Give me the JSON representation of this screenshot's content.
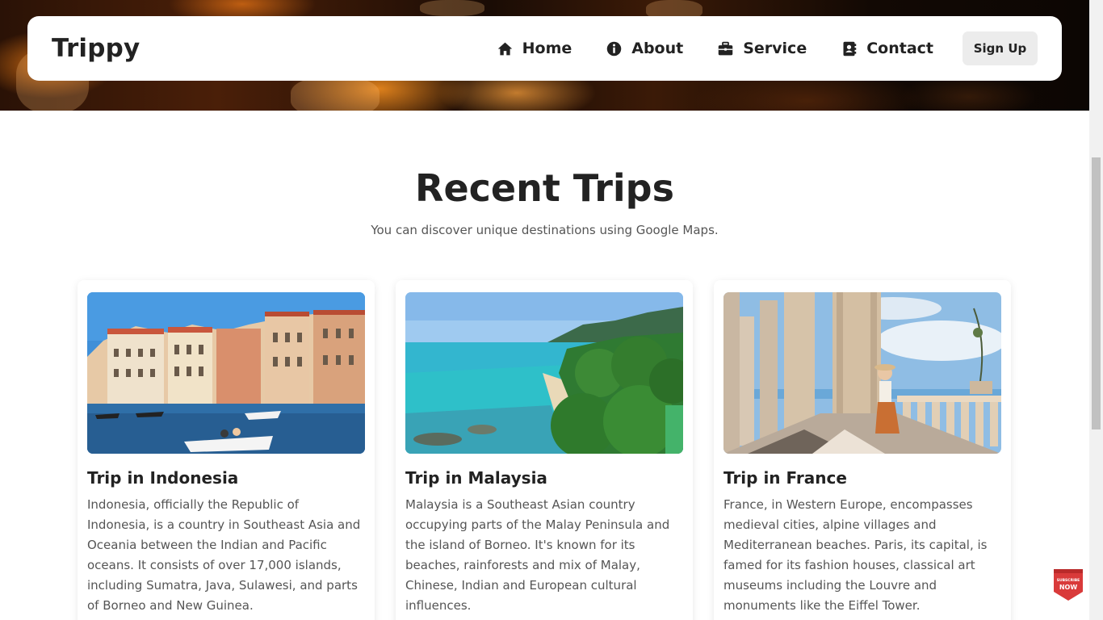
{
  "brand": "Trippy",
  "nav": {
    "items": [
      {
        "label": "Home",
        "icon": "home-icon"
      },
      {
        "label": "About",
        "icon": "info-icon"
      },
      {
        "label": "Service",
        "icon": "briefcase-icon"
      },
      {
        "label": "Contact",
        "icon": "contact-book-icon"
      }
    ],
    "signup_label": "Sign Up"
  },
  "section": {
    "title": "Recent Trips",
    "subtitle": "You can discover unique destinations using Google Maps."
  },
  "trips": [
    {
      "title": "Trip in Indonesia",
      "image": "venice-canal-photo",
      "text": "Indonesia, officially the Republic of Indonesia, is a country in Southeast Asia and Oceania between the Indian and Pacific oceans. It consists of over 17,000 islands, including Sumatra, Java, Sulawesi, and parts of Borneo and New Guinea."
    },
    {
      "title": "Trip in Malaysia",
      "image": "tropical-beach-photo",
      "text": "Malaysia is a Southeast Asian country occupying parts of the Malay Peninsula and the island of Borneo. It's known for its beaches, rainforests and mix of Malay, Chinese, Indian and European cultural influences."
    },
    {
      "title": "Trip in France",
      "image": "terrace-columns-photo",
      "text": "France, in Western Europe, encompasses medieval cities, alpine villages and Mediterranean beaches. Paris, its capital, is famed for its fashion houses, classical art museums including the Louvre and monuments like the Eiffel Tower."
    }
  ],
  "badge": {
    "text": "SUBSCRIBE NOW",
    "color": "#d93a3a"
  },
  "colors": {
    "text": "#222222",
    "muted": "#555555",
    "button": "#ececec"
  }
}
